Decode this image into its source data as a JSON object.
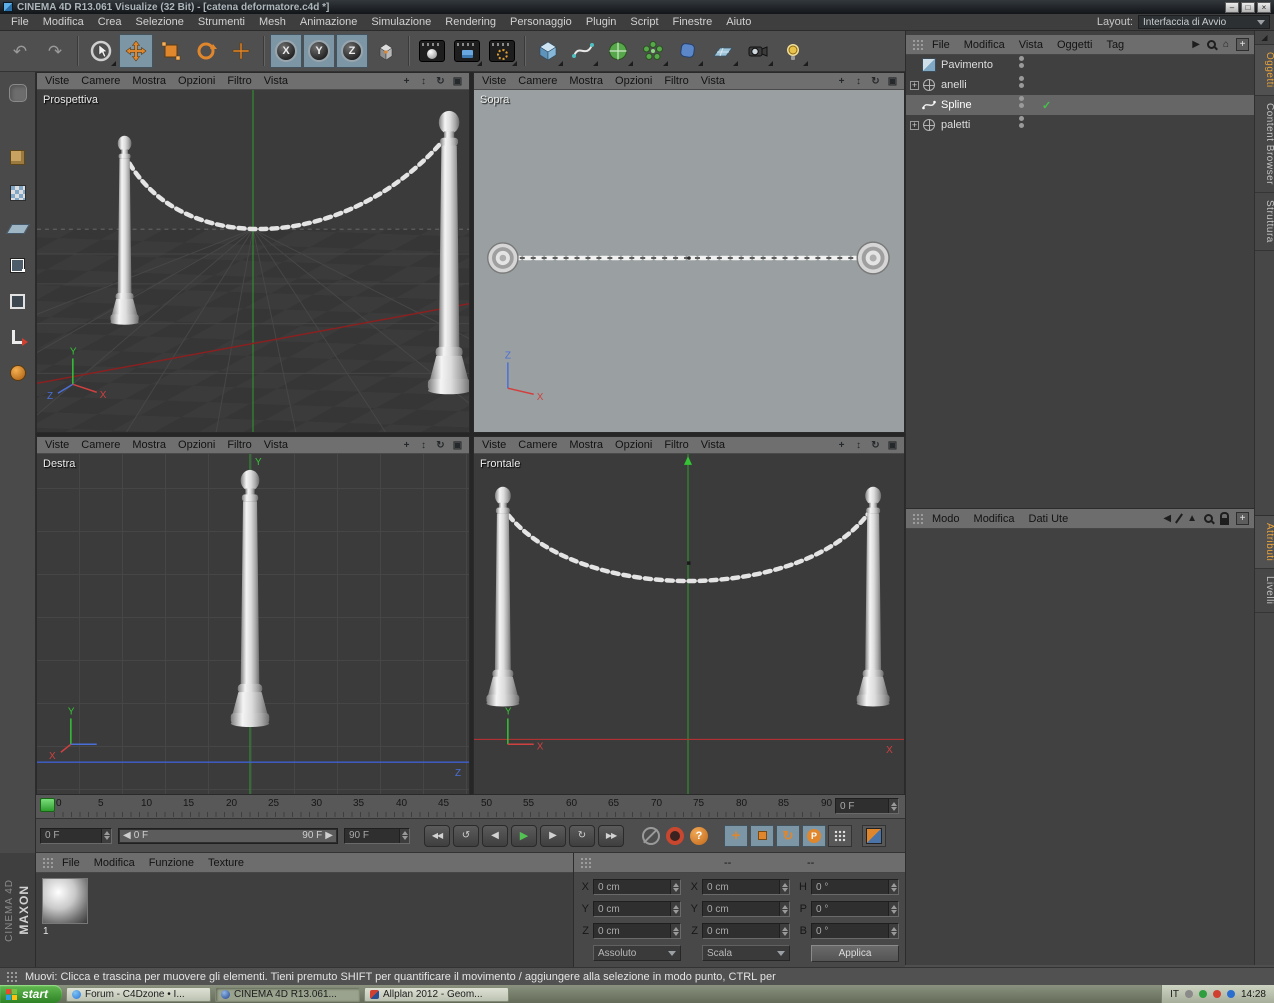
{
  "titlebar": {
    "title": "CINEMA 4D R13.061 Visualize (32 Bit) - [catena deformatore.c4d *]"
  },
  "menubar": {
    "items": [
      "File",
      "Modifica",
      "Crea",
      "Selezione",
      "Strumenti",
      "Mesh",
      "Animazione",
      "Simulazione",
      "Rendering",
      "Personaggio",
      "Plugin",
      "Script",
      "Finestre",
      "Aiuto"
    ],
    "layout_label": "Layout:",
    "layout_value": "Interfaccia di Avvio"
  },
  "toolbar": {
    "axis_buttons": [
      "X",
      "Y",
      "Z"
    ]
  },
  "viewport_menu": [
    "Viste",
    "Camere",
    "Mostra",
    "Opzioni",
    "Filtro",
    "Vista"
  ],
  "viewports": {
    "perspective": "Prospettiva",
    "top": "Sopra",
    "right": "Destra",
    "front": "Frontale"
  },
  "axes": {
    "x": "X",
    "y": "Y",
    "z": "Z"
  },
  "object_manager": {
    "menu": [
      "File",
      "Modifica",
      "Vista",
      "Oggetti",
      "Tag"
    ],
    "objects": [
      {
        "name": "Pavimento"
      },
      {
        "name": "anelli"
      },
      {
        "name": "Spline"
      },
      {
        "name": "paletti"
      }
    ],
    "tabs": [
      "Oggetti",
      "Content Browser",
      "Struttura"
    ]
  },
  "attribute_manager": {
    "menu": [
      "Modo",
      "Modifica",
      "Dati Ute"
    ],
    "tabs": [
      "Attributi",
      "Livelli"
    ]
  },
  "timeline": {
    "ticks": [
      "0",
      "5",
      "10",
      "15",
      "20",
      "25",
      "30",
      "35",
      "40",
      "45",
      "50",
      "55",
      "60",
      "65",
      "70",
      "75",
      "80",
      "85",
      "90"
    ],
    "frame_field": "0 F",
    "start_field": "0 F",
    "range_start": "0 F",
    "range_end": "90 F",
    "end_field": "90 F"
  },
  "materials": {
    "menu": [
      "File",
      "Modifica",
      "Funzione",
      "Texture"
    ],
    "material_label": "1"
  },
  "coordinates": {
    "col2_header": "--",
    "col3_header": "--",
    "pos_labels": [
      "X",
      "Y",
      "Z"
    ],
    "pos_values": [
      "0 cm",
      "0 cm",
      "0 cm"
    ],
    "size_labels": [
      "X",
      "Y",
      "Z"
    ],
    "size_values": [
      "0 cm",
      "0 cm",
      "0 cm"
    ],
    "rot_labels": [
      "H",
      "P",
      "B"
    ],
    "rot_values": [
      "0 °",
      "0 °",
      "0 °"
    ],
    "mode_position": "Assoluto",
    "mode_size": "Scala",
    "apply_button": "Applica"
  },
  "statusbar": {
    "text": "Muovi: Clicca e trascina per muovere gli elementi. Tieni premuto SHIFT per quantificare il movimento / aggiungere alla selezione in modo punto, CTRL per"
  },
  "branding": {
    "line1": "MAXON",
    "line2": "CINEMA 4D"
  },
  "taskbar": {
    "start": "start",
    "tasks": [
      "Forum - C4Dzone • I...",
      "CINEMA 4D R13.061...",
      "Allplan 2012 - Geom..."
    ],
    "tray_lang": "IT",
    "tray_time": "14:28"
  },
  "icons": {
    "undo": "↶",
    "redo": "↷",
    "pan": "+",
    "dolly": "↕",
    "orbit": "↻",
    "toggle_view": "▣",
    "jump_start": "◀◀",
    "step_back": "◀",
    "play": "▶",
    "step_fwd": "▶",
    "jump_end": "▶▶",
    "loop": "↺",
    "back": "◀",
    "arrow": "▶",
    "up": "▲",
    "plus": "+",
    "check": "✓",
    "home": "⌂",
    "question": "?",
    "param": "P",
    "win_min": "–",
    "win_max": "□",
    "win_close": "×"
  },
  "colors": {
    "accent_orange": "#e0862c",
    "active_teal": "#7d96a6",
    "tab_orange": "#e8a23b",
    "marker_green": "#2f9e2f",
    "viewport_dark": "#3b3b3b",
    "viewport_light": "#9aa0a1"
  }
}
